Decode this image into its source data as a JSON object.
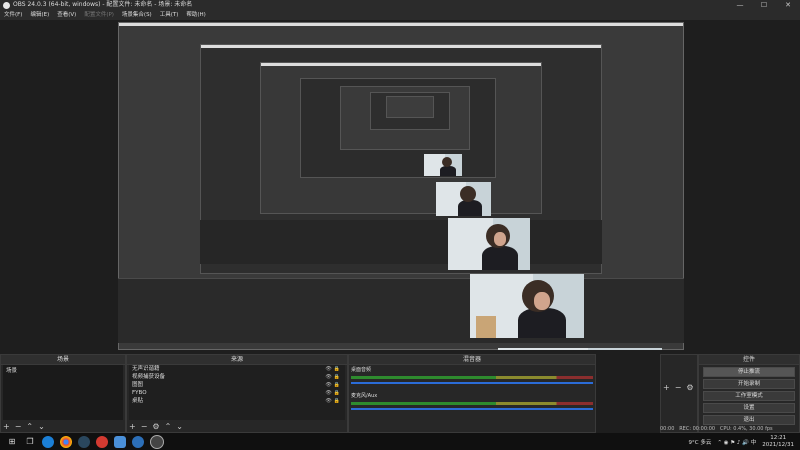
{
  "window": {
    "title": "OBS 24.0.3 (64-bit, windows) - 配置文件: 未命名 - 场景: 未命名",
    "controls": [
      "—",
      "☐",
      "✕"
    ]
  },
  "menu": [
    "文件(F)",
    "编辑(E)",
    "查看(V)",
    "配置文件(P)",
    "场景集合(S)",
    "工具(T)",
    "帮助(H)"
  ],
  "scenes": {
    "header": "场景",
    "items": [
      "场景"
    ]
  },
  "sources": {
    "header": "来源",
    "items": [
      "无声识谐籍",
      "视频捕获设备",
      "图图",
      "FYBO",
      "桌贴"
    ]
  },
  "mixer": {
    "header": "混音器",
    "tracks": [
      {
        "name": "桌面音频",
        "db": "0.0 dB"
      },
      {
        "name": "麦克风/Aux",
        "db": "0.0 dB"
      }
    ]
  },
  "controls": {
    "header": "控件",
    "buttons": [
      "停止推流",
      "开始录制",
      "工作室模式",
      "设置",
      "退出"
    ]
  },
  "status": {
    "time": "00:00",
    "rec": "REC: 00:00:00",
    "cpu": "CPU: 0.4%, 30.00 fps"
  },
  "taskbar": {
    "weather": "9°C 多云",
    "time": "12:21",
    "date": "2021/12/31"
  }
}
